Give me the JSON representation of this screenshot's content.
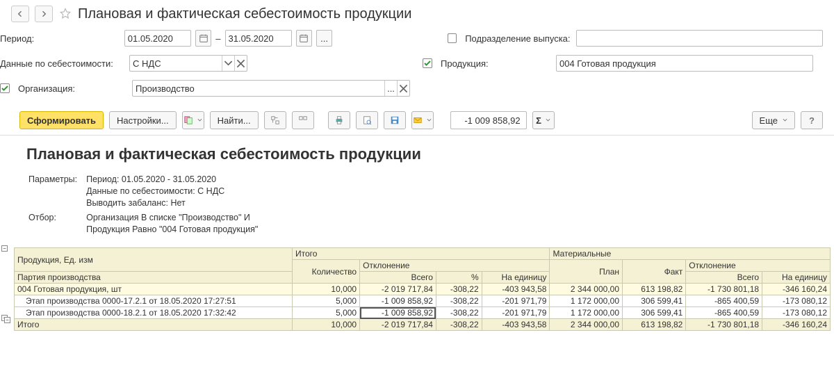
{
  "title": "Плановая и фактическая себестоимость продукции",
  "filters": {
    "period_label": "Период:",
    "date_from": "01.05.2020",
    "date_to": "31.05.2020",
    "dash": "–",
    "cost_label": "Данные по себестоимости:",
    "cost_value": "С НДС",
    "org_label": "Организация:",
    "org_checked": true,
    "org_value": "Производство",
    "dept_label": "Подразделение выпуска:",
    "dept_checked": false,
    "dept_value": "",
    "prod_label": "Продукция:",
    "prod_checked": true,
    "prod_value": "004 Готовая продукция"
  },
  "toolbar": {
    "form_btn": "Сформировать",
    "settings_btn": "Настройки...",
    "find_btn": "Найти...",
    "more_btn": "Еще",
    "num_display": "-1 009 858,92"
  },
  "report": {
    "title": "Плановая и фактическая себестоимость продукции",
    "params_caption": "Параметры:",
    "filter_caption": "Отбор:",
    "param_lines": [
      "Период: 01.05.2020 - 31.05.2020",
      "Данные по себестоимости: С НДС",
      "Выводить забаланс: Нет"
    ],
    "filter_lines": [
      "Организация В списке \"Производство\" И",
      "Продукция Равно \"004 Готовая продукция\""
    ],
    "headers": {
      "row1": {
        "c0": "Продукция, Ед. изм",
        "c1": "Итого",
        "c2": "Материальные"
      },
      "row2": {
        "c0": "Партия производства",
        "c1": "Количество",
        "c2": "Отклонение",
        "c3": "План",
        "c4": "Факт",
        "c5": "Отклонение"
      },
      "row3": {
        "c1": "Всего",
        "c2": "%",
        "c3": "На единицу",
        "c4": "Всего",
        "c5": "На единицу"
      }
    },
    "rows": [
      {
        "type": "group",
        "label": "004 Готовая продукция, шт",
        "qty": "10,000",
        "dev_total": "-2 019 717,84",
        "dev_pct": "-308,22",
        "dev_unit": "-403 943,58",
        "plan": "2 344 000,00",
        "fact": "613 198,82",
        "mdev_total": "-1 730 801,18",
        "mdev_unit": "-346 160,24"
      },
      {
        "type": "row",
        "label": "Этап производства 0000-17.2.1 от 18.05.2020 17:27:51",
        "qty": "5,000",
        "dev_total": "-1 009 858,92",
        "dev_pct": "-308,22",
        "dev_unit": "-201 971,79",
        "plan": "1 172 000,00",
        "fact": "306 599,41",
        "mdev_total": "-865 400,59",
        "mdev_unit": "-173 080,12"
      },
      {
        "type": "row",
        "label": "Этап производства 0000-18.2.1 от 18.05.2020 17:32:42",
        "qty": "5,000",
        "dev_total": "-1 009 858,92",
        "dev_pct": "-308,22",
        "dev_unit": "-201 971,79",
        "plan": "1 172 000,00",
        "fact": "306 599,41",
        "mdev_total": "-865 400,59",
        "mdev_unit": "-173 080,12"
      },
      {
        "type": "total",
        "label": "Итого",
        "qty": "10,000",
        "dev_total": "-2 019 717,84",
        "dev_pct": "-308,22",
        "dev_unit": "-403 943,58",
        "plan": "2 344 000,00",
        "fact": "613 198,82",
        "mdev_total": "-1 730 801,18",
        "mdev_unit": "-346 160,24"
      }
    ]
  }
}
